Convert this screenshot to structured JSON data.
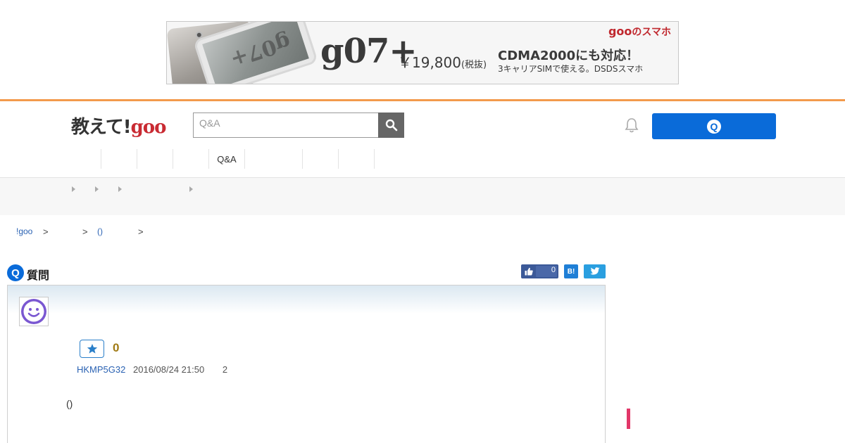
{
  "ad": {
    "brand": "goo",
    "brand_suffix": "のスマホ",
    "model": "g07+",
    "price": "￥19,800",
    "price_note": "(税抜)",
    "headline": "CDMA2000にも対応！",
    "subline": "3キャリアSIMで使える。DSDSスマホ",
    "screen_text": "g07+"
  },
  "header": {
    "logo_prefix": "教えて!",
    "logo_goo": "goo",
    "search_placeholder": "Q&A",
    "ask_button_icon": "Q"
  },
  "nav": {
    "items": [
      "",
      "",
      "",
      "",
      "Q&A",
      "",
      ""
    ]
  },
  "breadcrumb": {
    "items": [
      "!goo",
      "",
      "()",
      ""
    ],
    "separator": ">"
  },
  "question": {
    "heading_icon": "Q",
    "heading": "質問",
    "like_count": "0",
    "hatena_label": "B!",
    "star_count": "0",
    "user": "HKMP5G32",
    "date": "2016/08/24 21:50",
    "views": "2",
    "body": "()"
  },
  "colors": {
    "accent_blue": "#0a6bd9",
    "header_orange": "#f39a4c",
    "goo_red": "#c92b33",
    "star_gold": "#a07a14",
    "sidebar_pink": "#e23769"
  }
}
